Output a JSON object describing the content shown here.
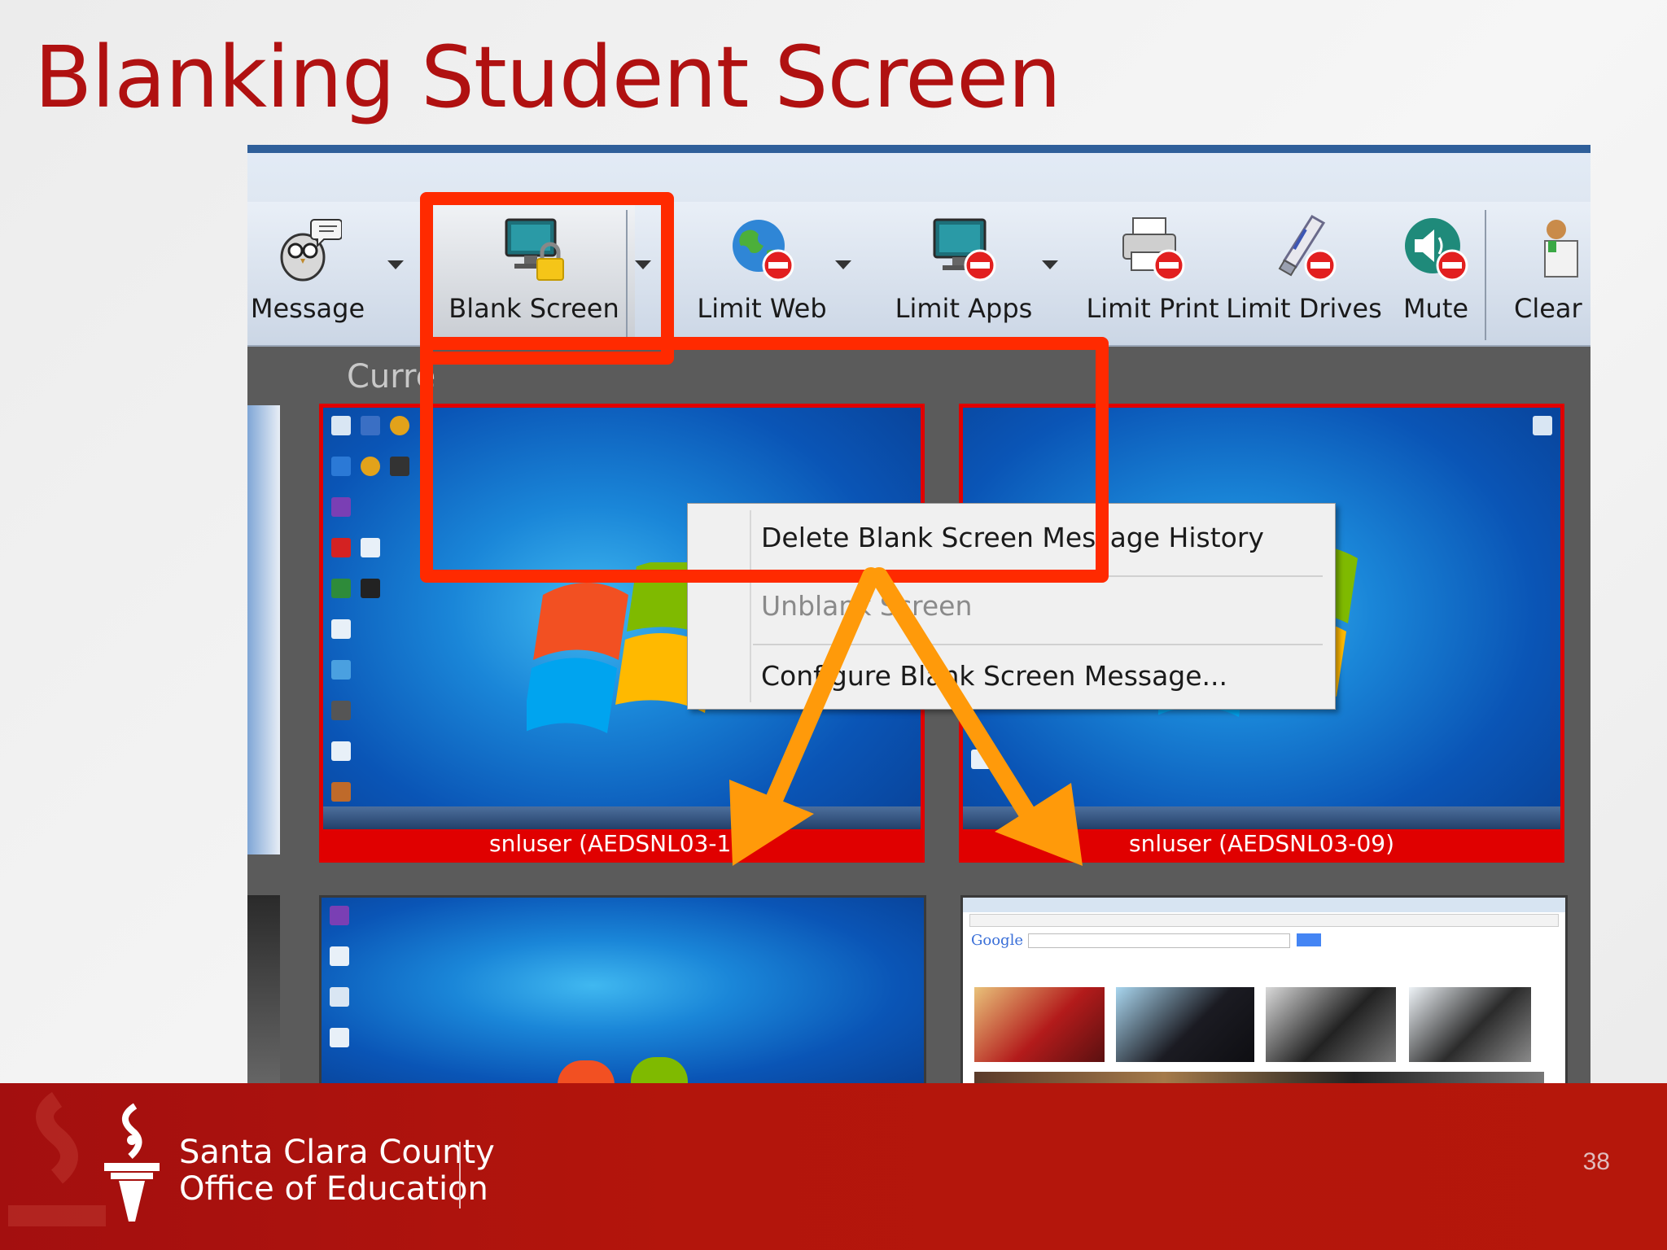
{
  "slide": {
    "title": "Blanking Student Screen",
    "page_number": "38"
  },
  "toolbar": {
    "buttons": [
      {
        "label": "Message",
        "icon": "owl-message-icon"
      },
      {
        "label": "Blank Screen",
        "icon": "monitor-lock-icon"
      },
      {
        "label": "Limit Web",
        "icon": "globe-block-icon"
      },
      {
        "label": "Limit Apps",
        "icon": "monitor-block-icon"
      },
      {
        "label": "Limit Print",
        "icon": "printer-block-icon"
      },
      {
        "label": "Limit Drives",
        "icon": "usb-block-icon"
      },
      {
        "label": "Mute",
        "icon": "speaker-block-icon"
      },
      {
        "label": "Clear D",
        "icon": "person-clear-icon"
      }
    ]
  },
  "view": {
    "current_label": "Curre"
  },
  "blank_menu": {
    "items": [
      {
        "label": "Delete Blank Screen Message History",
        "enabled": true
      },
      {
        "label": "Unblank Screen",
        "enabled": false
      },
      {
        "label": "Configure Blank Screen Message...",
        "enabled": true
      }
    ]
  },
  "thumbnails": [
    {
      "caption": "snluser (AEDSNL03-11)",
      "selected": true
    },
    {
      "caption": "snluser (AEDSNL03-09)",
      "selected": true
    },
    {
      "caption": "",
      "selected": false
    },
    {
      "caption": "",
      "selected": false
    }
  ],
  "browser_thumb": {
    "logo": "Google"
  },
  "footer": {
    "org_line1": "Santa Clara County",
    "org_line2": "Office of Education"
  },
  "colors": {
    "title_red": "#b01111",
    "highlight_red": "#ff2a00",
    "arrow_orange": "#ff9a0a",
    "selection_red": "#e00000",
    "footer_red": "#b3150c"
  }
}
